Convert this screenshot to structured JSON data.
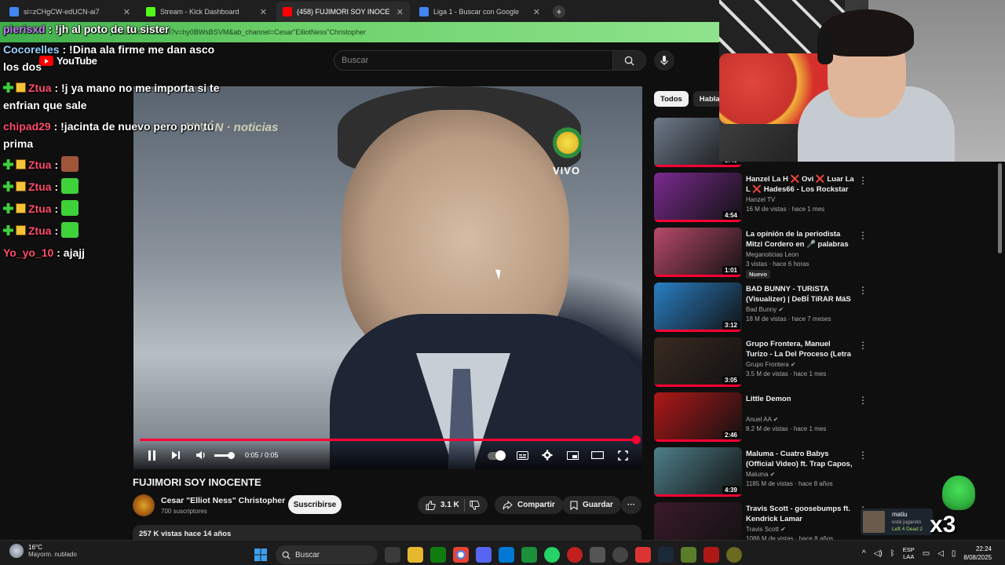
{
  "browser": {
    "tabs": [
      {
        "title": "si=zCHgCW-edUCN-ai7",
        "favicon_color": "#4285f4",
        "active": false
      },
      {
        "title": "Stream - Kick Dashboard",
        "favicon_color": "#53fc18",
        "active": false
      },
      {
        "title": "(458) FUJIMORI SOY INOCE",
        "favicon_color": "#ff0000",
        "active": true
      },
      {
        "title": "Liga 1 - Buscar con Google",
        "favicon_color": "#4285f4",
        "active": false
      }
    ],
    "new_tab": "+",
    "url": "youtube.com/watch?v=hy0BWsBSVM&ab_channel=Cesar\"ElliotNess\"Christopher"
  },
  "youtube": {
    "logo_text": "YouTube",
    "search_placeholder": "Buscar"
  },
  "player": {
    "time": "0:05 / 0:05",
    "progress": 1.0,
    "overlay_top_logo": "UNIÓN · noticias",
    "overlay_channel_text": "VIVO"
  },
  "video": {
    "title": "FUJIMORI SOY INOCENTE",
    "channel_name": "Cesar \"Elliot Ness\" Christopher",
    "subscribers": "700 suscriptores",
    "subscribe_label": "Suscribirse",
    "likes": "3.1 K",
    "share_label": "Compartir",
    "save_label": "Guardar",
    "more_label": "···",
    "views": "257 K vistas  hace 14 años"
  },
  "chat": [
    {
      "user": "pierisxd",
      "text": ": !jh al poto de tu sister",
      "color": "#c77dff",
      "badges": []
    },
    {
      "user": "Cocorelles",
      "text": ": !Dina ala firme me dan asco",
      "cont": "los dos",
      "color": "#9ad0ff",
      "badges": []
    },
    {
      "user": "Ztua",
      "text": ": !j ya mano no me importa si te",
      "cont": "enfrian que sale",
      "color": "#ff4d6d",
      "badges": [
        "plus",
        "crown"
      ]
    },
    {
      "user": "chipad29",
      "text": ": !jacinta de nuevo pero pon tu",
      "cont": "prima",
      "color": "#ff4d6d",
      "badges": []
    },
    {
      "user": "Ztua",
      "text": ":",
      "color": "#ff4d6d",
      "badges": [
        "plus",
        "crown"
      ],
      "emote": "#a0553a"
    },
    {
      "user": "Ztua",
      "text": ":",
      "color": "#ff4d6d",
      "badges": [
        "plus",
        "crown"
      ],
      "emote": "#3ed13a"
    },
    {
      "user": "Ztua",
      "text": ":",
      "color": "#ff4d6d",
      "badges": [
        "plus",
        "crown"
      ],
      "emote": "#3ed13a"
    },
    {
      "user": "Ztua",
      "text": ":",
      "color": "#ff4d6d",
      "badges": [
        "plus",
        "crown"
      ],
      "emote": "#3ed13a"
    },
    {
      "user": "Yo_yo_10",
      "text": ": ajajj",
      "color": "#ff4d6d",
      "badges": []
    }
  ],
  "sidebar": {
    "chips": [
      "Todos",
      "Hablar"
    ],
    "items": [
      {
        "title": "",
        "channel": "",
        "meta": "",
        "duration": "3:40",
        "thumb": "#6e7a8a",
        "verified": false,
        "new": false
      },
      {
        "title": "Hanzel La H ❌ Ovi ❌ Luar La L ❌ Hades66 - Los Rockstar ...",
        "channel": "Hanzel TV",
        "meta": "16 M de vistas · hace 1 mes",
        "duration": "4:54",
        "thumb": "#7a2a8f",
        "verified": false,
        "new": false
      },
      {
        "title": "La opinión de la periodista Mitzi Cordero en 🎤 palabras",
        "channel": "Meganoticias Leon",
        "meta": "3 vistas · hace 6 horas",
        "duration": "1:01",
        "thumb": "#b84a6a",
        "verified": false,
        "new": true,
        "new_label": "Nuevo"
      },
      {
        "title": "BAD BUNNY - TURiSTA (Visualizer) | DeBÍ TiRAR MáS ...",
        "channel": "Bad Bunny",
        "meta": "18 M de vistas · hace 7 meses",
        "duration": "3:12",
        "thumb": "#2a7fc4",
        "verified": true,
        "new": false
      },
      {
        "title": "Grupo Frontera, Manuel Turizo - La Del Proceso (Letra Oficial)",
        "channel": "Grupo Frontera",
        "meta": "3.5 M de vistas · hace 1 mes",
        "duration": "3:05",
        "thumb": "#3a2a22",
        "verified": true,
        "new": false
      },
      {
        "title": "Little Demon",
        "channel": "Anuel AA",
        "meta": "8.2 M de vistas · hace 1 mes",
        "duration": "2:46",
        "thumb": "#b01818",
        "verified": true,
        "new": false
      },
      {
        "title": "Maluma - Cuatro Babys (Official Video) ft. Trap Capos, Noriel, ...",
        "channel": "Maluma",
        "meta": "1185 M de vistas · hace 8 años",
        "duration": "4:39",
        "thumb": "#4f7f8a",
        "verified": true,
        "new": false
      },
      {
        "title": "Travis Scott - goosebumps ft. Kendrick Lamar",
        "channel": "Travis Scott",
        "meta": "1086 M de vistas · hace 8 años",
        "duration": "4:11",
        "thumb": "#3a1a2a",
        "verified": true,
        "new": false
      }
    ]
  },
  "notification": {
    "name": "matiu",
    "line1": "está jugando",
    "line2": "Left 4 Dead 2"
  },
  "overlay": {
    "multiplier": "x3"
  },
  "taskbar": {
    "temp": "16°C",
    "weather": "Mayorm. nublado",
    "search": "Buscar",
    "lang_top": "ESP",
    "lang_bottom": "LAA",
    "time": "22:24",
    "date": "8/08/2025"
  }
}
